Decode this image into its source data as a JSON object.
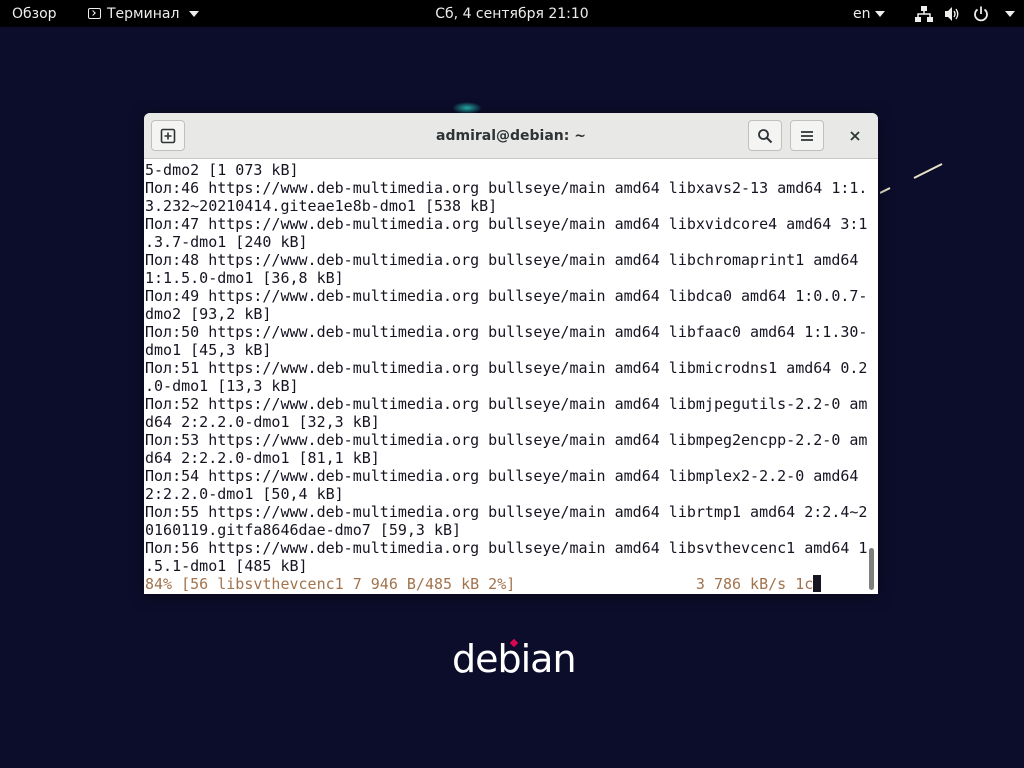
{
  "topbar": {
    "overview": "Обзор",
    "app_name": "Терминал",
    "clock": "Сб, 4 сентября  21:10",
    "language": "en",
    "icons": [
      "terminal-icon",
      "network-icon",
      "volume-icon",
      "power-icon"
    ]
  },
  "window": {
    "title": "admiral@debian: ~",
    "buttons": [
      "new-tab-icon",
      "search-icon",
      "menu-icon",
      "close-icon"
    ]
  },
  "terminal": {
    "lines": [
      "5-dmo2 [1 073 kB]",
      "Пол:46 https://www.deb-multimedia.org bullseye/main amd64 libxavs2-13 amd64 1:1.",
      "3.232~20210414.giteae1e8b-dmo1 [538 kB]",
      "Пол:47 https://www.deb-multimedia.org bullseye/main amd64 libxvidcore4 amd64 3:1",
      ".3.7-dmo1 [240 kB]",
      "Пол:48 https://www.deb-multimedia.org bullseye/main amd64 libchromaprint1 amd64",
      "1:1.5.0-dmo1 [36,8 kB]",
      "Пол:49 https://www.deb-multimedia.org bullseye/main amd64 libdca0 amd64 1:0.0.7-",
      "dmo2 [93,2 kB]",
      "Пол:50 https://www.deb-multimedia.org bullseye/main amd64 libfaac0 amd64 1:1.30-",
      "dmo1 [45,3 kB]",
      "Пол:51 https://www.deb-multimedia.org bullseye/main amd64 libmicrodns1 amd64 0.2",
      ".0-dmo1 [13,3 kB]",
      "Пол:52 https://www.deb-multimedia.org bullseye/main amd64 libmjpegutils-2.2-0 am",
      "d64 2:2.2.0-dmo1 [32,3 kB]",
      "Пол:53 https://www.deb-multimedia.org bullseye/main amd64 libmpeg2encpp-2.2-0 am",
      "d64 2:2.2.0-dmo1 [81,1 kB]",
      "Пол:54 https://www.deb-multimedia.org bullseye/main amd64 libmplex2-2.2-0 amd64",
      "2:2.2.0-dmo1 [50,4 kB]",
      "Пол:55 https://www.deb-multimedia.org bullseye/main amd64 librtmp1 amd64 2:2.4~2",
      "0160119.gitfa8646dae-dmo7 [59,3 kB]",
      "Пол:56 https://www.deb-multimedia.org bullseye/main amd64 libsvthevcenc1 amd64 1",
      ".5.1-dmo1 [485 kB]"
    ],
    "progress_line": "84% [56 libsvthevcenc1 7 946 B/485 kB 2%]                    3 786 kB/s 1c",
    "progress_color": "#a2734c"
  },
  "desktop": {
    "logo_text": "debian",
    "logo_dot_color": "#d70751",
    "background_color": "#0c0d2b"
  }
}
